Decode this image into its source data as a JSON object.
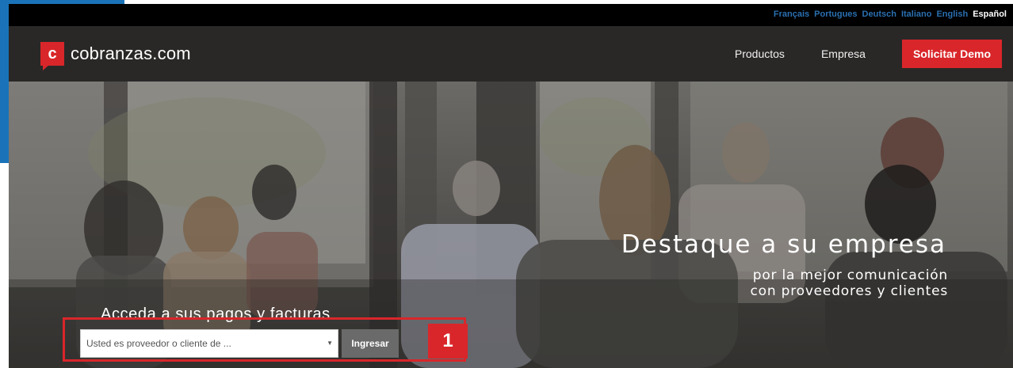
{
  "languages": [
    {
      "label": "Français",
      "active": false
    },
    {
      "label": "Portugues",
      "active": false
    },
    {
      "label": "Deutsch",
      "active": false
    },
    {
      "label": "Italiano",
      "active": false
    },
    {
      "label": "English",
      "active": false
    },
    {
      "label": "Español",
      "active": true
    }
  ],
  "header": {
    "logo_mark": "c",
    "logo_text": "cobranzas.com",
    "nav": [
      "Productos",
      "Empresa"
    ],
    "cta": "Solicitar Demo"
  },
  "hero": {
    "headline": "Destaque a su empresa",
    "subline_1": "por la mejor comunicación",
    "subline_2": "con proveedores y clientes"
  },
  "access": {
    "label": "Acceda a sus pagos y facturas",
    "select_value": "Usted es proveedor o cliente de ...",
    "select_arrow": "▼",
    "submit": "Ingresar"
  },
  "annotation": {
    "step_number": "1"
  },
  "colors": {
    "brand_red": "#d9262a",
    "link_blue": "#2a6fb0",
    "corner_blue": "#1a73b8"
  }
}
